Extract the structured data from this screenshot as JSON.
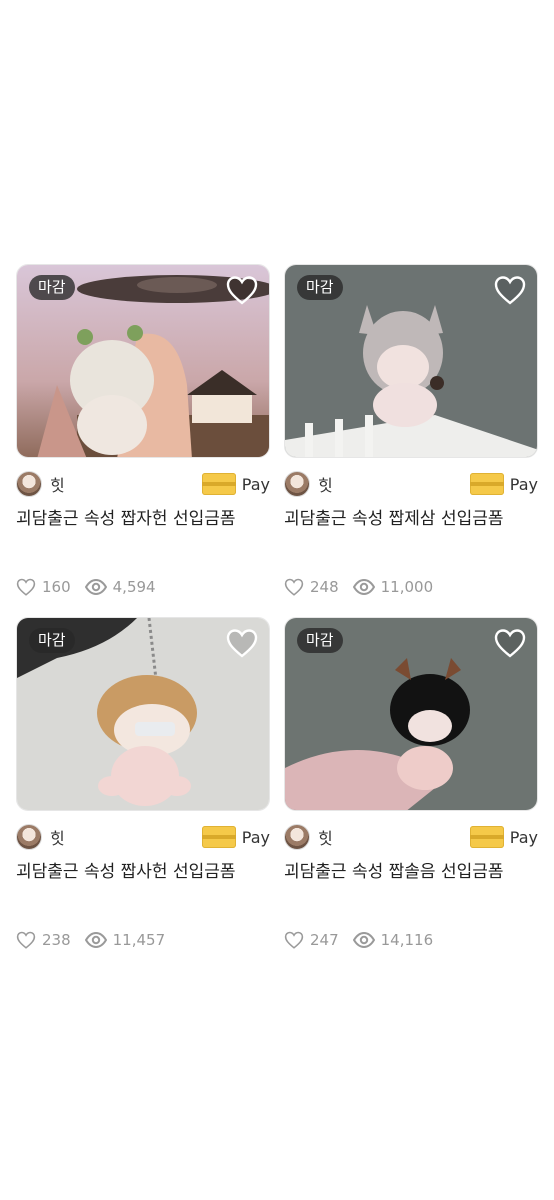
{
  "products": [
    {
      "badge": "마감",
      "seller": "힛",
      "pay_label": "Pay",
      "title": "괴담출근 속성 짭자헌 선입금폼",
      "likes": "160",
      "views": "4,594",
      "scene": "ufo"
    },
    {
      "badge": "마감",
      "seller": "힛",
      "pay_label": "Pay",
      "title": "괴담출근 속성 짭제삼 선입금폼",
      "likes": "248",
      "views": "11,000",
      "scene": "wolf"
    },
    {
      "badge": "마감",
      "seller": "힛",
      "pay_label": "Pay",
      "title": "괴담출근 속성 짭사헌 선입금폼",
      "likes": "238",
      "views": "11,457",
      "scene": "keychain"
    },
    {
      "badge": "마감",
      "seller": "힛",
      "pay_label": "Pay",
      "title": "괴담출근 속성 짭솔음 선입금폼",
      "likes": "247",
      "views": "14,116",
      "scene": "dark"
    }
  ]
}
